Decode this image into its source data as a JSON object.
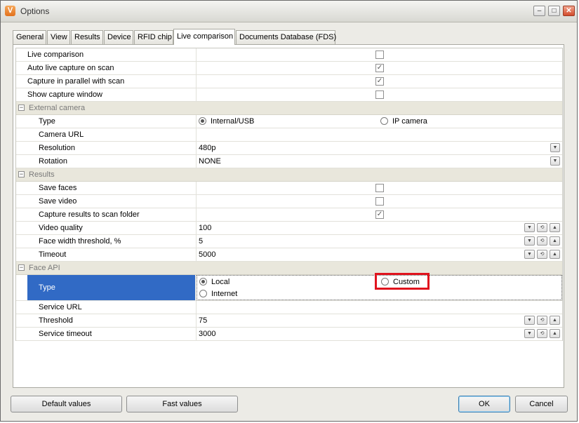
{
  "window": {
    "title": "Options",
    "icon": "shield-app-icon"
  },
  "titlebar_buttons": {
    "minimize": "–",
    "maximize": "□",
    "close": "✕"
  },
  "tabs": [
    "General",
    "View",
    "Results",
    "Device",
    "RFID chip",
    "Live comparison",
    "Documents Database (FDS)"
  ],
  "active_tab": "Live comparison",
  "rows": {
    "live_comparison": {
      "label": "Live comparison",
      "checked": false
    },
    "auto_live_capture": {
      "label": "Auto live capture on scan",
      "checked": true
    },
    "capture_parallel": {
      "label": "Capture in parallel with scan",
      "checked": true
    },
    "show_capture_window": {
      "label": "Show capture window",
      "checked": false
    }
  },
  "external_camera": {
    "category": "External camera",
    "type_label": "Type",
    "type_options": [
      "Internal/USB",
      "IP camera"
    ],
    "type_selected": "Internal/USB",
    "camera_url_label": "Camera URL",
    "camera_url_value": "",
    "resolution_label": "Resolution",
    "resolution_value": "480p",
    "rotation_label": "Rotation",
    "rotation_value": "NONE"
  },
  "results": {
    "category": "Results",
    "save_faces": {
      "label": "Save faces",
      "checked": false
    },
    "save_video": {
      "label": "Save video",
      "checked": false
    },
    "capture_to_folder": {
      "label": "Capture results to scan folder",
      "checked": true
    },
    "video_quality": {
      "label": "Video quality",
      "value": "100"
    },
    "face_width": {
      "label": "Face width threshold, %",
      "value": "5"
    },
    "timeout": {
      "label": "Timeout",
      "value": "5000"
    }
  },
  "face_api": {
    "category": "Face API",
    "type_label": "Type",
    "type_options": [
      "Local",
      "Custom",
      "Internet"
    ],
    "type_selected": "Local",
    "service_url_label": "Service URL",
    "service_url_value": "",
    "threshold": {
      "label": "Threshold",
      "value": "75"
    },
    "service_timeout": {
      "label": "Service timeout",
      "value": "3000"
    }
  },
  "buttons": {
    "default_values": "Default values",
    "fast_values": "Fast values",
    "ok": "OK",
    "cancel": "Cancel"
  },
  "glyphs": {
    "check": "✓",
    "collapse": "−",
    "dropdown": "▼",
    "spin_down": "▼",
    "spin_reset": "⟲",
    "spin_up": "▲"
  },
  "colors": {
    "selection": "#316ac5",
    "highlight_box": "#e0141e",
    "category_bg": "#e9e7dc"
  }
}
